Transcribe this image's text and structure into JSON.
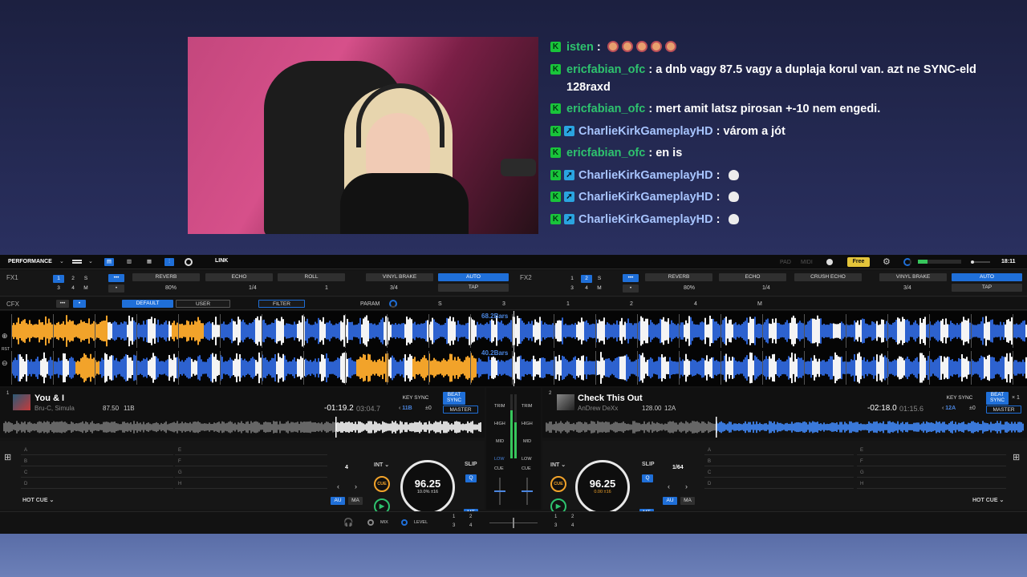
{
  "chat": [
    {
      "user": "isten",
      "text": "",
      "emotes": 5,
      "badges": [
        "k"
      ]
    },
    {
      "user": "ericfabian_ofc",
      "text": "a dnb vagy 87.5 vagy a duplaja korul van. azt ne SYNC-eld 128raxd",
      "emotes": 0,
      "badges": [
        "k"
      ]
    },
    {
      "user": "ericfabian_ofc",
      "text": "mert amit latsz pirosan +-10 nem engedi.",
      "emotes": 0,
      "badges": [
        "k"
      ]
    },
    {
      "user": "CharlieKirkGameplayHD",
      "text": "várom a jót",
      "emotes": 0,
      "badges": [
        "k",
        "p"
      ]
    },
    {
      "user": "ericfabian_ofc",
      "text": "en is",
      "emotes": 0,
      "badges": [
        "k"
      ]
    },
    {
      "user": "CharlieKirkGameplayHD",
      "text": "",
      "skull": true,
      "badges": [
        "k",
        "p"
      ]
    },
    {
      "user": "CharlieKirkGameplayHD",
      "text": "",
      "skull": true,
      "badges": [
        "k",
        "p"
      ]
    },
    {
      "user": "CharlieKirkGameplayHD",
      "text": "",
      "skull": true,
      "badges": [
        "k",
        "p"
      ]
    }
  ],
  "topbar": {
    "mode": "PERFORMANCE",
    "link": "LINK",
    "pad": "PAD",
    "midi": "MIDI",
    "free": "Free",
    "time": "18:11"
  },
  "fx1": {
    "label": "FX1",
    "nums": [
      "1",
      "2",
      "S",
      "3",
      "4",
      "M"
    ],
    "more": "•••",
    "reverb": "REVERB",
    "echo": "ECHO",
    "roll": "ROLL",
    "vinyl": "VINYL BRAKE",
    "auto": "AUTO",
    "tap": "TAP",
    "pct": "80%",
    "q": "1/4",
    "one": "1",
    "ratio": "3/4"
  },
  "fx2": {
    "label": "FX2",
    "nums": [
      "1",
      "2",
      "S",
      "3",
      "4",
      "M"
    ],
    "more": "•••",
    "reverb": "REVERB",
    "echo": "ECHO",
    "crush": "CRUSH ECHO",
    "vinyl": "VINYL BRAKE",
    "auto": "AUTO",
    "tap": "TAP",
    "pct": "80%",
    "q": "1/4",
    "ratio": "3/4"
  },
  "cfx": {
    "label": "CFX",
    "more": "•••",
    "def": "DEFAULT",
    "user": "USER",
    "filter": "FILTER",
    "param": "PARAM",
    "s": "S",
    "n3": "3",
    "n1": "1",
    "n2": "2",
    "n4": "4",
    "m": "M"
  },
  "waves": {
    "bars1": "68.2Bars",
    "bars2": "40.2Bars",
    "rst": "RST"
  },
  "deck1": {
    "num": "1",
    "title": "You & I",
    "artist": "Bru-C, Simula",
    "bpm": "87.50",
    "key": "11B",
    "remain": "-01:19.2",
    "total": "03:04.7",
    "keysync": "KEY SYNC",
    "beat": "BEAT",
    "sync": "SYNC",
    "keyv": "11B",
    "pm": "±0",
    "master": "MASTER",
    "beatnum": "4",
    "int": "INT",
    "slip": "SLIP",
    "q": "Q",
    "cue": "CUE",
    "au": "AU",
    "ma": "MA",
    "mt": "MT",
    "jog": "96.25",
    "jogsub": "10.0% ±16",
    "hotcue": "HOT CUE",
    "pads": [
      "A",
      "B",
      "C",
      "D",
      "E",
      "F",
      "G",
      "H"
    ]
  },
  "deck2": {
    "num": "2",
    "title": "Check This Out",
    "artist": "AnDrew DeXx",
    "bpm": "128.00",
    "key": "12A",
    "remain": "-02:18.0",
    "total": "01:15.6",
    "keysync": "KEY SYNC",
    "beat": "BEAT",
    "sync": "SYNC",
    "x1": "× 1",
    "keyv": "12A",
    "pm": "±0",
    "master": "MASTER",
    "beatnum": "1/64",
    "int": "INT",
    "slip": "SLIP",
    "q": "Q",
    "cue": "CUE",
    "au": "AU",
    "ma": "MA",
    "mt": "MT",
    "jog": "96.25",
    "jogsub": "0.00 ±16",
    "hotcue": "HOT CUE",
    "pads": [
      "A",
      "B",
      "C",
      "D",
      "E",
      "F",
      "G",
      "H"
    ]
  },
  "mixer": {
    "trim": "TRIM",
    "high": "HIGH",
    "mid": "MID",
    "low": "LOW",
    "cue": "CUE",
    "mix": "MIX",
    "level": "LEVEL",
    "g1": [
      "1",
      "2",
      "3",
      "4"
    ],
    "g2": [
      "1",
      "2",
      "3",
      "4"
    ]
  },
  "colors": {
    "blue": "#1f6fd8",
    "orange": "#f2a32a",
    "green": "#2ec26e"
  }
}
